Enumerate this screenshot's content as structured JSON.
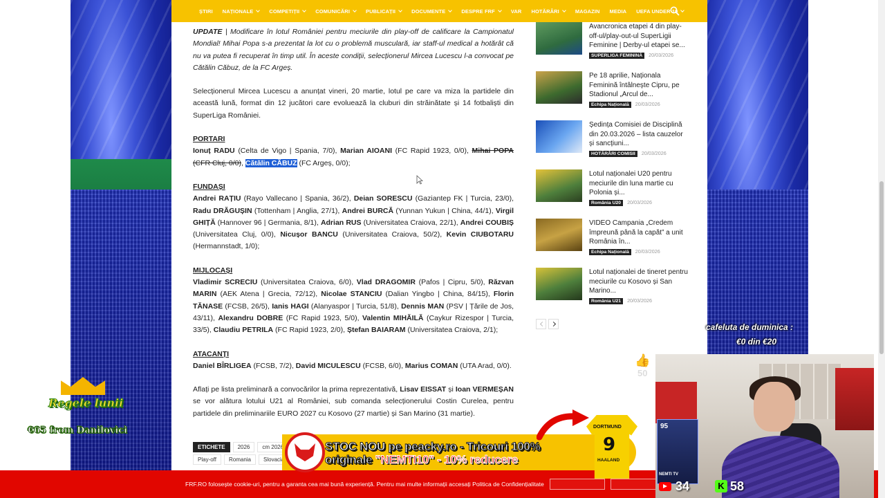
{
  "nav": {
    "items": [
      {
        "label": "ȘTIRI",
        "dropdown": false
      },
      {
        "label": "NAȚIONALE",
        "dropdown": true
      },
      {
        "label": "COMPETIȚII",
        "dropdown": true
      },
      {
        "label": "COMUNICĂRI",
        "dropdown": true
      },
      {
        "label": "PUBLICAȚII",
        "dropdown": true
      },
      {
        "label": "DOCUMENTE",
        "dropdown": true
      },
      {
        "label": "DESPRE FRF",
        "dropdown": true
      },
      {
        "label": "VAR",
        "dropdown": false
      },
      {
        "label": "HOTĂRÂRI",
        "dropdown": true
      },
      {
        "label": "MAGAZIN",
        "dropdown": false
      },
      {
        "label": "MEDIA",
        "dropdown": false
      },
      {
        "label": "UEFA UNDER 19",
        "dropdown": true
      }
    ],
    "search_icon": "search-icon",
    "accent": "#f7c200"
  },
  "article": {
    "update_label": "UPDATE",
    "update_text": " | Modificare în lotul României pentru meciurile din play-off de calificare la Campionatul Mondial! Mihai Popa s-a prezentat la lot cu o problemă musculară, iar staff-ul medical a hotărât că nu va putea fi recuperat în timp util. În aceste condiții, selecționerul Mircea Lucescu l-a convocat pe Cătălin Căbuz, de la FC Argeș.",
    "intro": "Selecționerul Mircea Lucescu a anunțat vineri, 20 martie, lotul pe care va miza la partidele din această lună, format din 12 jucători care evoluează la cluburi din străinătate și 14 fotbaliști din SuperLiga României.",
    "portari_heading": "PORTARI",
    "portari": {
      "p1_name": "Ionuț RADU",
      "p1_club": " (Celta de Vigo | Spania, 7/0), ",
      "p2_name": "Marian AIOANI",
      "p2_club": " (FC Rapid 1923, 0/0), ",
      "p3_struck": "Mihai POPA (CFR Cluj, 0/0)",
      "sep": ", ",
      "p4_name": "Cătălin CĂBUZ",
      "p4_club": " (FC Argeș, 0/0);"
    },
    "fundasi_heading": "FUNDAȘI",
    "fundasi": [
      {
        "name": "Andrei RAȚIU",
        "club": " (Rayo Vallecano | Spania, 36/2), "
      },
      {
        "name": "Deian SORESCU",
        "club": " (Gaziantep FK | Turcia, 23/0), "
      },
      {
        "name": "Radu DRĂGUȘIN",
        "club": " (Tottenham | Anglia, 27/1), "
      },
      {
        "name": "Andrei BURCĂ",
        "club": " (Yunnan Yukun | China, 44/1), "
      },
      {
        "name": "Virgil GHIȚĂ",
        "club": " (Hannover 96 | Germania, 8/1), "
      },
      {
        "name": "Adrian RUS",
        "club": " (Universitatea Craiova, 22/1), "
      },
      {
        "name": "Andrei COUBIȘ",
        "club": " (Universitatea Cluj, 0/0), "
      },
      {
        "name": "Nicușor BANCU",
        "club": " (Universitatea Craiova, 50/2), "
      },
      {
        "name": "Kevin CIUBOTARU",
        "club": " (Hermannstadt, 1/0);"
      }
    ],
    "mijlocasi_heading": "MIJLOCAȘI",
    "mijlocasi": [
      {
        "name": "Vladimir SCRECIU",
        "club": " (Universitatea Craiova, 6/0), "
      },
      {
        "name": "Vlad DRAGOMIR",
        "club": " (Pafos | Cipru, 5/0), "
      },
      {
        "name": "Răzvan MARIN",
        "club": " (AEK Atena | Grecia, 72/12), "
      },
      {
        "name": "Nicolae STANCIU",
        "club": " (Dalian Yingbo | China, 84/15), "
      },
      {
        "name": "Florin TĂNASE",
        "club": " (FCSB, 26/5), "
      },
      {
        "name": "Ianis HAGI",
        "club": " (Alanyaspor | Turcia, 51/8), "
      },
      {
        "name": "Dennis MAN",
        "club": " (PSV | Țările de Jos, 43/11), "
      },
      {
        "name": "Alexandru DOBRE",
        "club": " (FC Rapid 1923, 5/0), "
      },
      {
        "name": "Valentin MIHĂILĂ",
        "club": " (Caykur Rizespor | Turcia, 33/5), "
      },
      {
        "name": "Claudiu PETRILA",
        "club": " (FC Rapid 1923, 2/0), "
      },
      {
        "name": "Ștefan BAIARAM",
        "club": " (Universitatea Craiova, 2/1);"
      }
    ],
    "atacanti_heading": "ATACANȚI",
    "atacanti": [
      {
        "name": "Daniel BÎRLIGEA",
        "club": " (FCSB, 7/2), "
      },
      {
        "name": "David MICULESCU",
        "club": " (FCSB, 6/0), "
      },
      {
        "name": "Marius COMAN",
        "club": " (UTA Arad, 0/0)."
      }
    ],
    "outro_a": "Aflați pe lista preliminară a convocărilor la prima reprezentativă, ",
    "outro_n1": "Lisav EISSAT",
    "outro_b": " și ",
    "outro_n2": "Ioan VERMEȘAN",
    "outro_c": " se vor alătura lotului U21 al României, sub comanda selecționerului Costin Curelea, pentru partidele din preliminariile EURO 2027 cu Kosovo (27 martie) și San Marino (31 martie)."
  },
  "tags": {
    "label": "ETICHETE",
    "row1": [
      "2026",
      "cm 2026"
    ],
    "row2": [
      "Play-off",
      "Romania",
      "Slovacia"
    ]
  },
  "sidebar": [
    {
      "title": "Avancronica etapei 4 din play-off-ul/play-out-ul SuperLigii Feminine | Derby-ul etapei se...",
      "category": "SUPERLIGA FEMININĂ",
      "date": "20/03/2026"
    },
    {
      "title": "Pe 18 aprilie, Naționala Feminină întâlnește Cipru, pe Stadionul „Arcul de...",
      "category": "Echipa Națională",
      "date": "20/03/2026"
    },
    {
      "title": "Ședința Comisiei de Disciplină din 20.03.2026 – lista cauzelor și sancțiuni...",
      "category": "HOTĂRÂRI COMISII",
      "date": "20/03/2026"
    },
    {
      "title": "Lotul naționalei U20 pentru meciurile din luna martie cu Polonia și...",
      "category": "România U20",
      "date": "20/03/2026"
    },
    {
      "title": "VIDEO Campania „Credem împreună până la capăt” a unit România în...",
      "category": "Echipa Națională",
      "date": "20/03/2026"
    },
    {
      "title": "Lotul naționalei de tineret pentru meciurile cu Kosovo și San Marino...",
      "category": "România U21",
      "date": "20/03/2026"
    }
  ],
  "cookie": {
    "text": "FRF.RO folosește cookie-uri, pentru a garanta cea mai bună experiență. Pentru mai multe informații accesați Politica de Confidențialitate",
    "bg": "#e10600"
  },
  "ad": {
    "line1": "STOC NOU pe peacky.ro - Tricouri 100%",
    "line2_a": "originale ",
    "line2_promo": "\"NEMTI10\" - 10% reducere",
    "logo_text": "PEACKY",
    "shirt_brand": "DORTMUND",
    "shirt_number": "9",
    "shirt_name": "HAALAND"
  },
  "stream": {
    "likes": "50",
    "goal_line1": "cafeluta de duminica :",
    "goal_line2": "€0 din €20",
    "winner_title": "Regele lunii",
    "winner_sub": "€65 from Danilovici",
    "card_rating": "95",
    "card_name": "NEMTI TV",
    "yt_count": "34",
    "kick_count": "58"
  }
}
